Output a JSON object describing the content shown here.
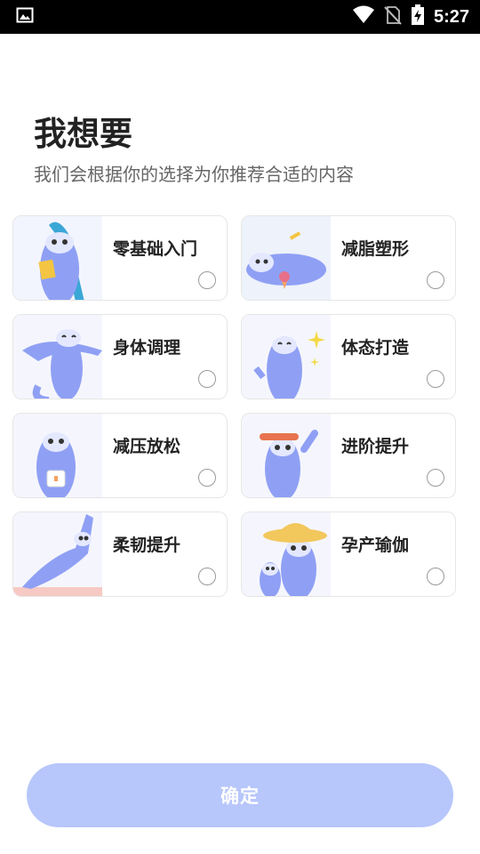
{
  "status_bar": {
    "time": "5:27",
    "icons": [
      "image-icon",
      "wifi-icon",
      "no-sim-icon",
      "battery-charging-icon"
    ]
  },
  "header": {
    "title": "我想要",
    "subtitle": "我们会根据你的选择为你推荐合适的内容"
  },
  "options": [
    {
      "label": "零基础入门",
      "selected": false
    },
    {
      "label": "减脂塑形",
      "selected": false
    },
    {
      "label": "身体调理",
      "selected": false
    },
    {
      "label": "体态打造",
      "selected": false
    },
    {
      "label": "减压放松",
      "selected": false
    },
    {
      "label": "进阶提升",
      "selected": false
    },
    {
      "label": "柔韧提升",
      "selected": false
    },
    {
      "label": "孕产瑜伽",
      "selected": false
    }
  ],
  "confirm": {
    "label": "确定",
    "enabled": false
  },
  "colors": {
    "accent": "#b7c6fb",
    "mascot": "#8fa0f4",
    "border": "#e6e6e6"
  }
}
